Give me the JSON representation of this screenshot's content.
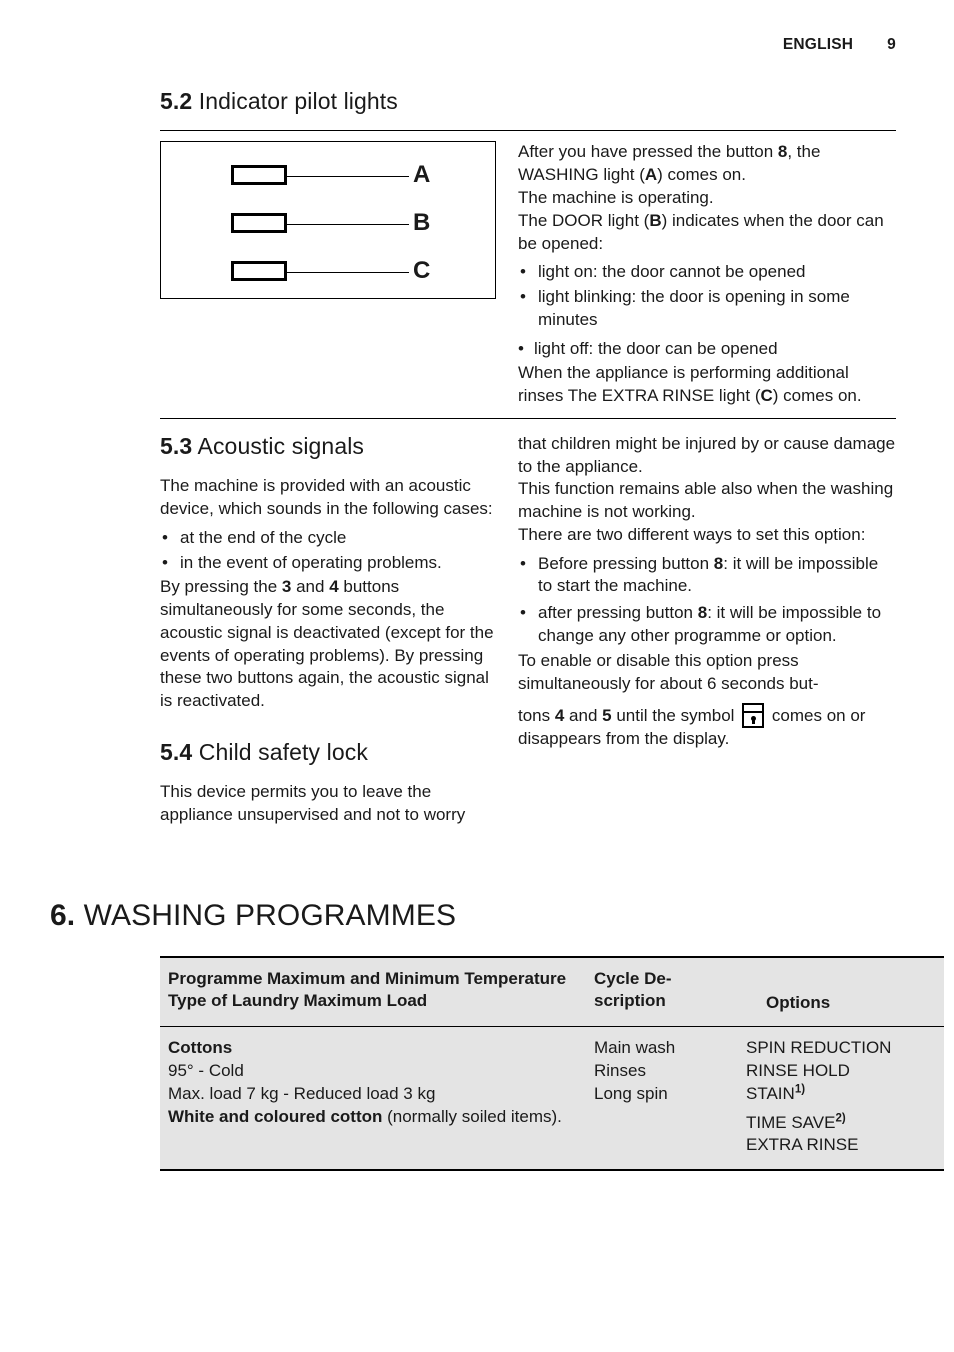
{
  "header": {
    "language": "ENGLISH",
    "page_number": "9"
  },
  "sections": {
    "s52": {
      "number": "5.2",
      "title": "Indicator pilot lights",
      "figure": {
        "labels": [
          "A",
          "B",
          "C"
        ]
      },
      "right_text": {
        "p1_part1": "After you have pressed the button ",
        "p1_bold1": "8",
        "p1_part2": ", the WASHING light (",
        "p1_bold2": "A",
        "p1_part3": ") comes on.",
        "p2": "The machine is operating.",
        "p3_part1": "The DOOR light (",
        "p3_bold": "B",
        "p3_part2": ") indicates when the door can be opened:",
        "bullets": [
          "light on: the door cannot be opened",
          "light blinking: the door is opening in some minutes",
          "light off: the door can be opened"
        ],
        "p4_part1": "When the appliance is performing additional rinses The EXTRA RINSE light (",
        "p4_bold": "C",
        "p4_part2": ") comes on."
      }
    },
    "s53": {
      "number": "5.3",
      "title": "Acoustic signals",
      "intro": "The machine is provided with an acoustic device, which sounds in the following cases:",
      "bullets": [
        "at the end of the cycle",
        "in the event of operating problems."
      ],
      "p_part1": "By pressing the ",
      "p_bold1": "3",
      "p_part2": " and ",
      "p_bold2": "4",
      "p_part3": " buttons simultaneously for some seconds, the acoustic signal is deactivated (except for the events of operating problems). By pressing these two buttons again, the acoustic signal is reactivated."
    },
    "s54": {
      "number": "5.4",
      "title": "Child safety lock",
      "p1": "This device permits you to leave the appliance unsupervised and not to worry",
      "right_continuation": "that children might be injured by or cause damage to the appliance.",
      "p2": "This function remains able also when the washing machine is not working.",
      "p3": "There are two different ways to set this option:",
      "bullets": [
        {
          "pre": "Before pressing button ",
          "bold": "8",
          "post": ": it will be impossible to start the machine."
        },
        {
          "pre": "after pressing button ",
          "bold": "8",
          "post": ": it will be impossible to change any other programme or option."
        }
      ],
      "p4": "To enable or disable this option press simultaneously for about 6 seconds but-",
      "p5_part1": "tons ",
      "p5_bold1": "4",
      "p5_part2": " and ",
      "p5_bold2": "5",
      "p5_part3": " until the symbol ",
      "p5_part4": " comes on or disappears from the display.",
      "symbol_name": "child-lock-symbol"
    }
  },
  "chapter": {
    "number": "6.",
    "title": "WASHING PROGRAMMES"
  },
  "table": {
    "headers": {
      "col1_lines": [
        "Programme",
        "Maximum and Minimum Temperature",
        "Type of Laundry",
        "Maximum Load"
      ],
      "col2_lines": [
        "Cycle De-",
        "scription"
      ],
      "col3": "Options"
    },
    "rows": [
      {
        "programme_name": "Cottons",
        "temperature": "95° - Cold",
        "load": "Max. load 7 kg - Reduced load 3 kg",
        "laundry_bold": "White and coloured cotton",
        "laundry_rest": " (normally soiled items).",
        "cycle_description": [
          "Main wash",
          "Rinses",
          "Long spin"
        ],
        "options": [
          {
            "label": "SPIN REDUCTION",
            "footnote": ""
          },
          {
            "label": "RINSE HOLD",
            "footnote": ""
          },
          {
            "label": "STAIN",
            "footnote": "1)"
          },
          {
            "label": "TIME SAVE",
            "footnote": "2)"
          },
          {
            "label": "EXTRA RINSE",
            "footnote": ""
          }
        ]
      }
    ]
  },
  "colors": {
    "table_background": "#e4e4e4",
    "text": "#1a1a1a",
    "rule": "#000000"
  }
}
